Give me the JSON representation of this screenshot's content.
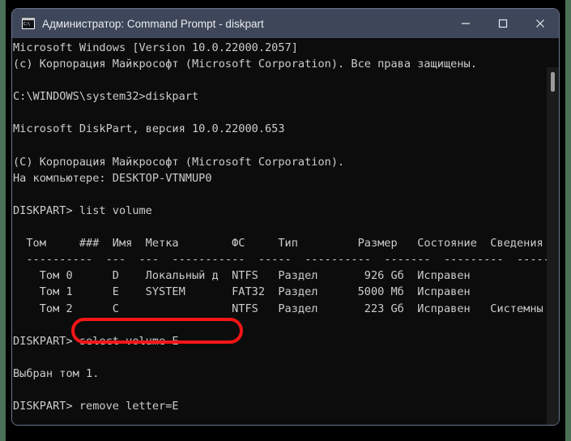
{
  "window": {
    "title": "Администратор: Command Prompt - diskpart",
    "icon_name": "command-prompt-icon",
    "icon_glyph": "C:\\",
    "titlebar_color": "#3e4759",
    "background_color": "#0c0c0c",
    "text_color": "#cccccc",
    "desktop_color": "#4b7256",
    "controls": [
      {
        "name": "minimize",
        "glyph": "—"
      },
      {
        "name": "maximize",
        "glyph": "□"
      },
      {
        "name": "close",
        "glyph": "✕"
      }
    ]
  },
  "console": {
    "lines": [
      "Microsoft Windows [Version 10.0.22000.2057]",
      "(c) Корпорация Майкрософт (Microsoft Corporation). Все права защищены.",
      "",
      "C:\\WINDOWS\\system32>diskpart",
      "",
      "Microsoft DiskPart, версия 10.0.22000.653",
      "",
      "(C) Корпорация Майкрософт (Microsoft Corporation).",
      "На компьютере: DESKTOP-VTNMUP0",
      "",
      "DISKPART> list volume",
      "",
      "  Том     ###  Имя  Метка        ФС     Тип         Размер   Состояние  Сведения",
      "  ----------  ---  ---  -----------  -----  ----------  -------  ---------  --------",
      "    Том 0      D    Локальный д  NTFS   Раздел       926 Gб  Исправен",
      "    Том 1      E    SYSTEM       FAT32  Раздел      5000 Mб  Исправен",
      "    Том 2      C                 NTFS   Раздел       223 Gб  Исправен   Системны",
      "",
      "DISKPART> select volume E",
      "",
      "Выбран том 1.",
      "",
      "DISKPART> remove letter=E"
    ]
  },
  "annotation": {
    "type": "red-rounded-rectangle",
    "color": "#f41616",
    "targets_text": "remove letter=E"
  }
}
